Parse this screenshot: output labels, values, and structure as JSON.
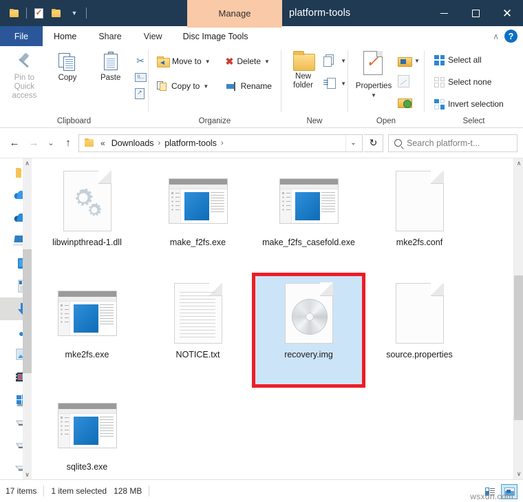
{
  "titlebar": {
    "quick_access_items": [
      {
        "name": "properties-quick-icon",
        "label": "Properties"
      },
      {
        "name": "new-folder-quick-icon",
        "label": "New folder"
      },
      {
        "name": "customize-quick-access-icon",
        "label": "Customize Quick Access Toolbar"
      }
    ],
    "contextual_tab": "Manage",
    "window_title": "platform-tools",
    "minimize": "–",
    "maximize": "□",
    "close": "✕"
  },
  "tabs": {
    "file": "File",
    "items": [
      {
        "label": "Home",
        "active": true
      },
      {
        "label": "Share",
        "active": false
      },
      {
        "label": "View",
        "active": false
      },
      {
        "label": "Disc Image Tools",
        "active": false,
        "contextual": true
      }
    ],
    "collapse_ribbon": "∧",
    "help": "?"
  },
  "ribbon": {
    "groups": [
      {
        "title": "Clipboard",
        "big_buttons": [
          {
            "label": "Pin to Quick\naccess",
            "line1": "Pin to Quick",
            "line2": "access",
            "disabled": true
          },
          {
            "label": "Copy",
            "line1": "Copy",
            "line2": "",
            "disabled": false
          },
          {
            "label": "Paste",
            "line1": "Paste",
            "line2": "",
            "disabled": false
          }
        ],
        "small_buttons": [
          {
            "label": "Cut",
            "icon": "scissors-icon"
          },
          {
            "label": "Copy path",
            "icon": "copy-path-icon"
          },
          {
            "label": "Paste shortcut",
            "icon": "paste-shortcut-icon"
          }
        ]
      },
      {
        "title": "Organize",
        "small_buttons": [
          {
            "label": "Move to",
            "icon": "move-to-icon",
            "has_caret": true
          },
          {
            "label": "Delete",
            "icon": "delete-icon",
            "has_caret": true
          },
          {
            "label": "Copy to",
            "icon": "copy-to-icon",
            "has_caret": true
          },
          {
            "label": "Rename",
            "icon": "rename-icon",
            "has_caret": false
          }
        ]
      },
      {
        "title": "New",
        "big_buttons": [
          {
            "label": "New folder",
            "line1": "New",
            "line2": "folder"
          }
        ],
        "small_buttons": [
          {
            "label": "New item",
            "icon": "new-item-icon",
            "has_caret": true
          },
          {
            "label": "Easy access",
            "icon": "easy-access-icon",
            "has_caret": true
          }
        ]
      },
      {
        "title": "Open",
        "big_buttons": [
          {
            "label": "Properties",
            "line1": "Properties",
            "line2": "▾"
          }
        ],
        "small_buttons": [
          {
            "label": "Open",
            "icon": "open-folder-icon",
            "has_caret": true
          },
          {
            "label": "Edit",
            "icon": "edit-icon",
            "has_caret": false
          },
          {
            "label": "History",
            "icon": "history-icon",
            "has_caret": false
          }
        ]
      },
      {
        "title": "Select",
        "small_buttons": [
          {
            "label": "Select all",
            "icon": "select-all-icon"
          },
          {
            "label": "Select none",
            "icon": "select-none-icon"
          },
          {
            "label": "Invert selection",
            "icon": "invert-selection-icon"
          }
        ]
      }
    ]
  },
  "addressbar": {
    "back": "←",
    "forward": "→",
    "recent": "⌄",
    "up": "↑",
    "breadcrumb": {
      "folder_icon": "folder-icon",
      "overflow": "«",
      "items": [
        "Downloads",
        "platform-tools"
      ],
      "separator": "›",
      "dropdown": "⌄"
    },
    "refresh": "↻",
    "search": {
      "placeholder": "Search platform-t...",
      "icon": "search-icon"
    }
  },
  "navpane": {
    "items": [
      {
        "name": "quick-access",
        "icon": "folder-icon",
        "selected": false
      },
      {
        "name": "onedrive-personal",
        "icon": "cloud-icon",
        "selected": false
      },
      {
        "name": "onedrive-business",
        "icon": "cloud-icon",
        "selected": false
      },
      {
        "name": "this-pc",
        "icon": "computer-icon",
        "selected": false
      },
      {
        "name": "desktop",
        "icon": "desktop-icon",
        "selected": false
      },
      {
        "name": "documents",
        "icon": "documents-icon",
        "selected": false
      },
      {
        "name": "downloads",
        "icon": "download-arrow-icon",
        "selected": true
      },
      {
        "name": "music",
        "icon": "music-note-icon",
        "selected": false
      },
      {
        "name": "pictures",
        "icon": "pictures-icon",
        "selected": false
      },
      {
        "name": "videos",
        "icon": "videos-icon",
        "selected": false
      },
      {
        "name": "windows-drive",
        "icon": "windows-drive-icon",
        "selected": false
      },
      {
        "name": "local-disk-d",
        "icon": "drive-icon",
        "selected": false
      },
      {
        "name": "local-disk-e",
        "icon": "drive-icon",
        "selected": false
      },
      {
        "name": "usb-drive",
        "icon": "usb-drive-icon",
        "selected": false
      }
    ],
    "scroll_up": "∧",
    "scroll_down": "∨"
  },
  "files": [
    {
      "name": "libwinpthread-1.dll",
      "icon": "dll-gears-icon",
      "selected": false
    },
    {
      "name": "make_f2fs.exe",
      "icon": "exe-app-icon",
      "selected": false
    },
    {
      "name": "make_f2fs_casefold.exe",
      "icon": "exe-app-icon",
      "selected": false
    },
    {
      "name": "mke2fs.conf",
      "icon": "blank-document-icon",
      "selected": false
    },
    {
      "name": "mke2fs.exe",
      "icon": "exe-app-icon",
      "selected": false
    },
    {
      "name": "NOTICE.txt",
      "icon": "text-document-icon",
      "selected": false
    },
    {
      "name": "recovery.img",
      "icon": "disc-image-icon",
      "selected": true
    },
    {
      "name": "source.properties",
      "icon": "blank-document-icon",
      "selected": false
    },
    {
      "name": "sqlite3.exe",
      "icon": "exe-app-icon",
      "selected": false
    }
  ],
  "content_scroll": {
    "up": "∧",
    "down": "∨"
  },
  "statusbar": {
    "item_count": "17 items",
    "selection_info": "1 item selected",
    "selection_size": "128 MB",
    "details_view": "Details view",
    "thumbnail_view": "Large icons view",
    "watermark": "wsxdn.com"
  },
  "colors": {
    "titlebar": "#1f3a52",
    "file_tab": "#2b579a",
    "contextual_tab": "#f9c9a8",
    "selection_fill": "#cce4f7",
    "highlight_box": "#ee1c25",
    "accent_blue": "#0e6cb4"
  }
}
